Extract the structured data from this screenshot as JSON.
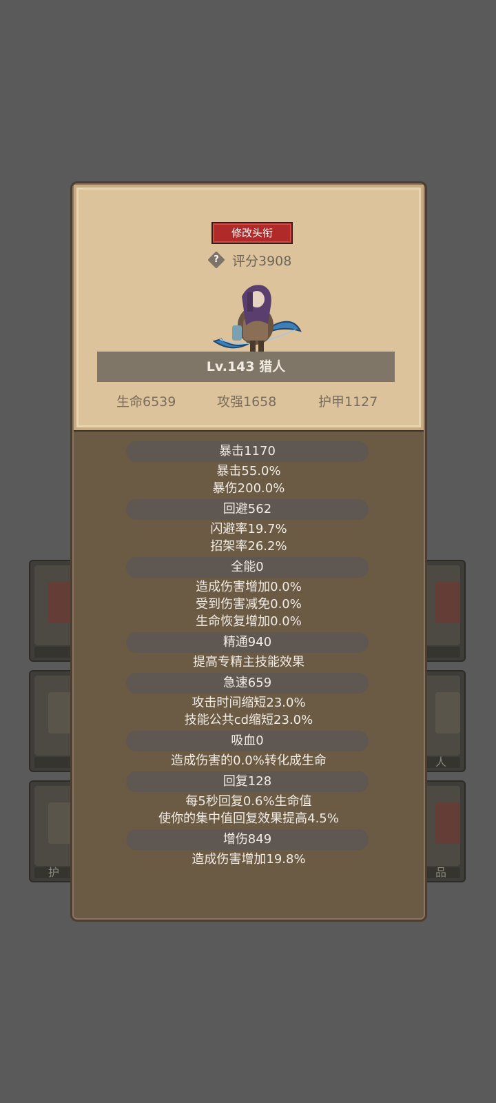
{
  "background_slots": {
    "left": [
      {
        "label": ""
      },
      {
        "label": ""
      },
      {
        "label": "护"
      }
    ],
    "right": [
      {
        "label": ""
      },
      {
        "label": "人"
      },
      {
        "label": "品"
      }
    ]
  },
  "card": {
    "title_button": "修改头衔",
    "help_icon": "question-diamond-icon",
    "score": "评分3908",
    "level_class": "Lv.143 猎人",
    "hp": "生命6539",
    "attack": "攻强1658",
    "armor": "护甲1127"
  },
  "details": [
    {
      "category": "暴击1170",
      "lines": [
        "暴击55.0%",
        "暴伤200.0%"
      ]
    },
    {
      "category": "回避562",
      "lines": [
        "闪避率19.7%",
        "招架率26.2%"
      ]
    },
    {
      "category": "全能0",
      "lines": [
        "造成伤害增加0.0%",
        "受到伤害减免0.0%",
        "生命恢复增加0.0%"
      ]
    },
    {
      "category": "精通940",
      "lines": [
        "提高专精主技能效果"
      ]
    },
    {
      "category": "急速659",
      "lines": [
        "攻击时间缩短23.0%",
        "技能公共cd缩短23.0%"
      ]
    },
    {
      "category": "吸血0",
      "lines": [
        "造成伤害的0.0%转化成生命"
      ]
    },
    {
      "category": "回复128",
      "lines": [
        "每5秒回复0.6%生命值",
        "使你的集中值回复效果提高4.5%"
      ]
    },
    {
      "category": "增伤849",
      "lines": [
        "造成伤害增加19.8%"
      ]
    }
  ],
  "colors": {
    "page_bg": "#5a5a5a",
    "modal_bg": "#6b5a44",
    "card_bg": "#ddc39b",
    "title_button": "#b12a2a",
    "category_pill": "#5f5751"
  }
}
